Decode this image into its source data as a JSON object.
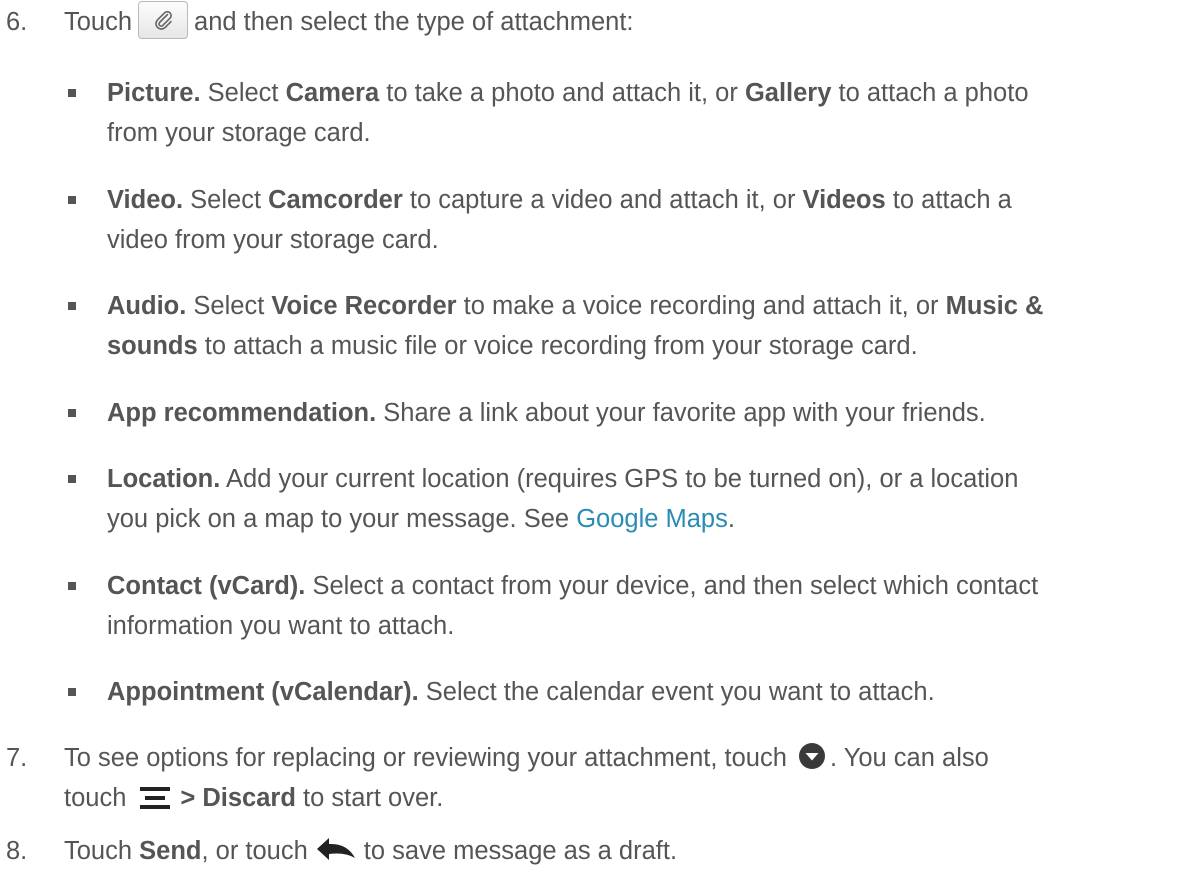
{
  "step6": {
    "number": "6.",
    "before_icon": "Touch",
    "icon": "paperclip-icon",
    "after_icon": "and then select the type of attachment:"
  },
  "bullets": [
    {
      "term": "Picture.",
      "t1": "Select",
      "b1": "Camera",
      "t2": "to take a photo and attach it, or",
      "b2": "Gallery",
      "t3": "to attach a photo",
      "line2": "from your storage card."
    },
    {
      "term": "Video.",
      "t1": "Select",
      "b1": "Camcorder",
      "t2": "to capture a video and attach it, or",
      "b2": "Videos",
      "t3": "to attach a",
      "line2": "video from your storage card."
    },
    {
      "term": "Audio.",
      "t1": "Select",
      "b1": "Voice Recorder",
      "t2": "to make a voice recording and attach it, or",
      "b2": "Music &",
      "b3": "sounds",
      "t3": "to attach a music file or voice recording from your storage card."
    },
    {
      "term": "App recommendation.",
      "text": "Share a link about your favorite app with your friends."
    },
    {
      "term": "Location.",
      "text": "Add your current location (requires GPS to be turned on), or a location",
      "line2": "you pick on a map to your message. See",
      "link": "Google Maps",
      "end": "."
    },
    {
      "term": "Contact (vCard).",
      "text": "Select a contact from your device, and then select which contact",
      "line2": "information you want to attach."
    },
    {
      "term": "Appointment (vCalendar).",
      "text": "Select the calendar event you want to attach."
    }
  ],
  "step7": {
    "number": "7.",
    "text1": "To see options for replacing or reviewing your attachment, touch",
    "icon1": "circle-down-arrow-icon",
    "text2": ". You can also",
    "text3": "touch",
    "icon2": "menu-icon",
    "bold": "> Discard",
    "text4": "to start over."
  },
  "step8": {
    "number": "8.",
    "text1": "Touch",
    "bold": "Send",
    "text2": ", or touch",
    "icon": "back-arrow-icon",
    "text3": "to save message as a draft."
  },
  "colors": {
    "text": "#555555",
    "link": "#2a8bb5"
  }
}
